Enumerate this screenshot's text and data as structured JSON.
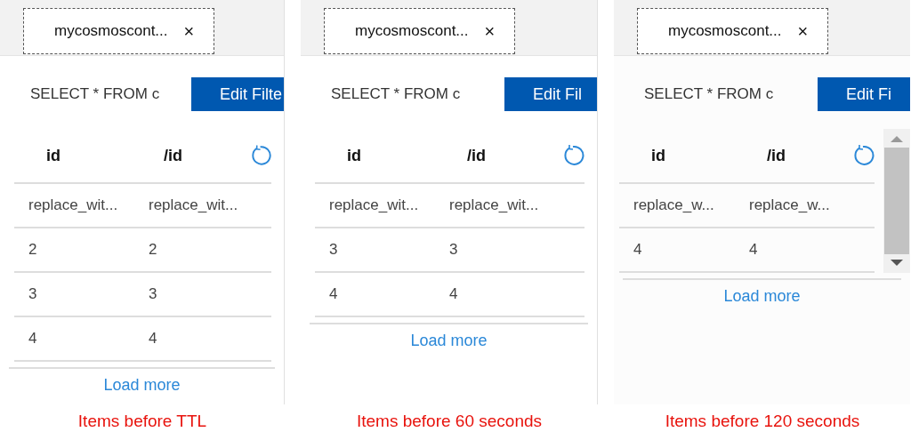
{
  "panels": [
    {
      "tab": {
        "title": "mycosmoscont...",
        "close": "×"
      },
      "query": "SELECT * FROM c",
      "button": "Edit Filte",
      "columns": [
        "id",
        "/id"
      ],
      "rows": [
        [
          "replace_wit...",
          "replace_wit..."
        ],
        [
          "2",
          "2"
        ],
        [
          "3",
          "3"
        ],
        [
          "4",
          "4"
        ]
      ],
      "scrollbar": false,
      "load_more": "Load more",
      "caption": "Items before TTL"
    },
    {
      "tab": {
        "title": "mycosmoscont...",
        "close": "×"
      },
      "query": "SELECT * FROM c",
      "button": "Edit Fil",
      "columns": [
        "id",
        "/id"
      ],
      "rows": [
        [
          "replace_wit...",
          "replace_wit..."
        ],
        [
          "3",
          "3"
        ],
        [
          "4",
          "4"
        ]
      ],
      "scrollbar": false,
      "load_more": "Load more",
      "caption": "Items before 60 seconds"
    },
    {
      "tab": {
        "title": "mycosmoscont...",
        "close": "×"
      },
      "query": "SELECT * FROM c",
      "button": "Edit Fi",
      "columns": [
        "id",
        "/id"
      ],
      "rows": [
        [
          "replace_w...",
          "replace_w..."
        ],
        [
          "4",
          "4"
        ]
      ],
      "scrollbar": true,
      "load_more": "Load more",
      "caption": "Items before 120 seconds"
    }
  ]
}
